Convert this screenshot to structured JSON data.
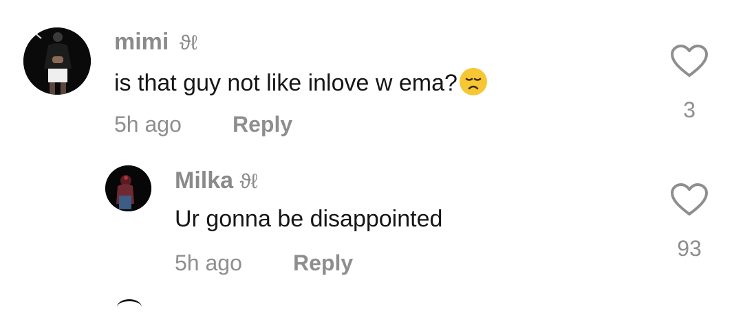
{
  "comments": [
    {
      "username": "mimi",
      "username_suffix": "ϑℓ",
      "text": "is that guy not like inlove w ema?",
      "emoji": "disappointed-face-emoji",
      "time": "5h ago",
      "reply_label": "Reply",
      "like_count": "3"
    },
    {
      "username": "Milka",
      "username_suffix": "ϑℓ",
      "text": "Ur gonna be disappointed",
      "time": "5h ago",
      "reply_label": "Reply",
      "like_count": "93"
    }
  ],
  "icons": {
    "like": "heart-outline-icon"
  },
  "colors": {
    "text": "#161616",
    "muted": "#8e8e8e",
    "emoji": "#f6c634"
  }
}
